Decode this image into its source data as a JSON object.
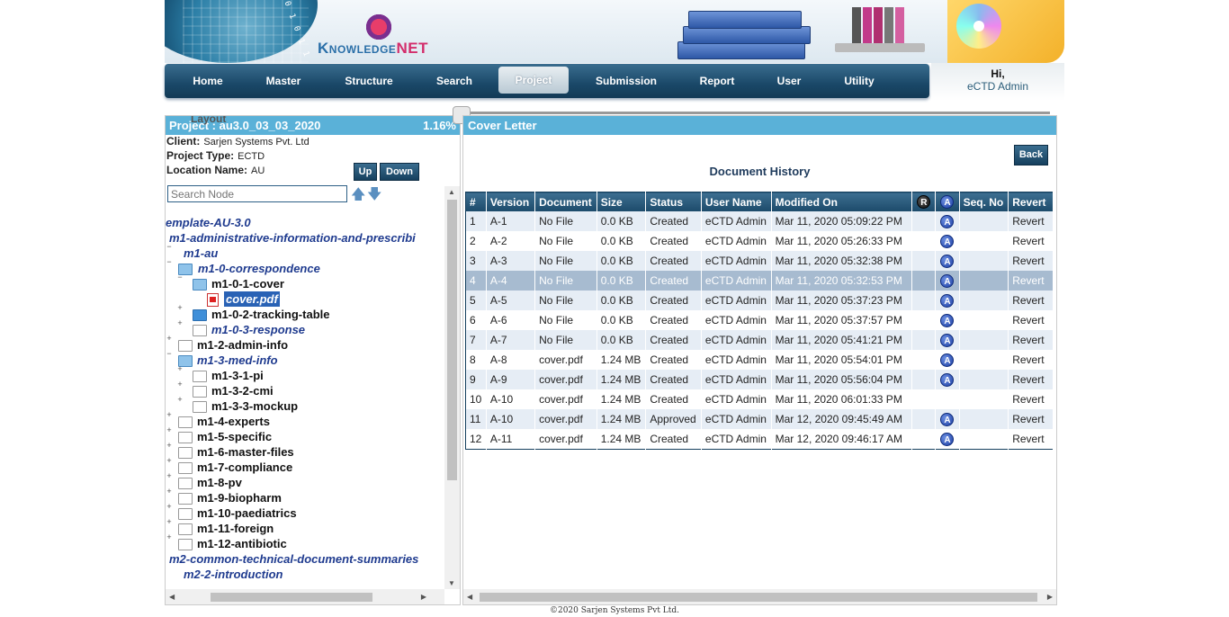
{
  "brand": {
    "logo_prefix": "Knowledge",
    "logo_suffix": "NET",
    "binary": "0 1 0 1 1 0 1 0"
  },
  "nav": {
    "items": [
      "Home",
      "Master",
      "Structure",
      "Search",
      "Project",
      "Submission",
      "Report",
      "User",
      "Utility"
    ],
    "active": "Project"
  },
  "user": {
    "greeting": "Hi,",
    "name": "eCTD Admin"
  },
  "left": {
    "header_label": "Project : au3.0_03_03_2020",
    "overlay_label": "Layout",
    "percent": "1.16%",
    "client_label": "Client:",
    "client_value": "Sarjen Systems Pvt. Ltd",
    "type_label": "Project Type:",
    "type_value": "ECTD",
    "location_label": "Location Name:",
    "location_value": "AU",
    "up_button": "Up",
    "down_button": "Down",
    "search_placeholder": "Search Node",
    "tree": [
      {
        "label": "emplate-AU-3.0",
        "style": "it"
      },
      {
        "label": "m1-administrative-information-and-prescribi",
        "style": "it"
      },
      {
        "label": "m1-au",
        "style": "it"
      },
      {
        "label": "m1-0-correspondence",
        "style": "it"
      },
      {
        "label": "m1-0-1-cover",
        "style": "bk"
      },
      {
        "label": "cover.pdf",
        "style": "sel"
      },
      {
        "label": "m1-0-2-tracking-table",
        "style": "bk"
      },
      {
        "label": "m1-0-3-response",
        "style": "it"
      },
      {
        "label": "m1-2-admin-info",
        "style": "bk"
      },
      {
        "label": "m1-3-med-info",
        "style": "it"
      },
      {
        "label": "m1-3-1-pi",
        "style": "bk"
      },
      {
        "label": "m1-3-2-cmi",
        "style": "bk"
      },
      {
        "label": "m1-3-3-mockup",
        "style": "bk"
      },
      {
        "label": "m1-4-experts",
        "style": "bk"
      },
      {
        "label": "m1-5-specific",
        "style": "bk"
      },
      {
        "label": "m1-6-master-files",
        "style": "bk"
      },
      {
        "label": "m1-7-compliance",
        "style": "bk"
      },
      {
        "label": "m1-8-pv",
        "style": "bk"
      },
      {
        "label": "m1-9-biopharm",
        "style": "bk"
      },
      {
        "label": "m1-10-paediatrics",
        "style": "bk"
      },
      {
        "label": "m1-11-foreign",
        "style": "bk"
      },
      {
        "label": "m1-12-antibiotic",
        "style": "bk"
      },
      {
        "label": "m2-common-technical-document-summaries",
        "style": "it"
      },
      {
        "label": "m2-2-introduction",
        "style": "it"
      }
    ]
  },
  "right": {
    "header": "Cover Letter",
    "back_button": "Back",
    "title": "Document History",
    "columns": [
      "#",
      "Version",
      "Document",
      "Size",
      "Status",
      "User Name",
      "Modified On",
      "R",
      "A",
      "Seq. No",
      "Revert"
    ],
    "rows": [
      [
        "1",
        "A-1",
        "No File",
        "0.0 KB",
        "Created",
        "eCTD Admin",
        "Mar 11, 2020 05:09:22 PM",
        "",
        "A",
        "",
        "Revert"
      ],
      [
        "2",
        "A-2",
        "No File",
        "0.0 KB",
        "Created",
        "eCTD Admin",
        "Mar 11, 2020 05:26:33 PM",
        "",
        "A",
        "",
        "Revert"
      ],
      [
        "3",
        "A-3",
        "No File",
        "0.0 KB",
        "Created",
        "eCTD Admin",
        "Mar 11, 2020 05:32:38 PM",
        "",
        "A",
        "",
        "Revert"
      ],
      [
        "4",
        "A-4",
        "No File",
        "0.0 KB",
        "Created",
        "eCTD Admin",
        "Mar 11, 2020 05:32:53 PM",
        "",
        "A",
        "",
        "Revert"
      ],
      [
        "5",
        "A-5",
        "No File",
        "0.0 KB",
        "Created",
        "eCTD Admin",
        "Mar 11, 2020 05:37:23 PM",
        "",
        "A",
        "",
        "Revert"
      ],
      [
        "6",
        "A-6",
        "No File",
        "0.0 KB",
        "Created",
        "eCTD Admin",
        "Mar 11, 2020 05:37:57 PM",
        "",
        "A",
        "",
        "Revert"
      ],
      [
        "7",
        "A-7",
        "No File",
        "0.0 KB",
        "Created",
        "eCTD Admin",
        "Mar 11, 2020 05:41:21 PM",
        "",
        "A",
        "",
        "Revert"
      ],
      [
        "8",
        "A-8",
        "cover.pdf",
        "1.24 MB",
        "Created",
        "eCTD Admin",
        "Mar 11, 2020 05:54:01 PM",
        "",
        "A",
        "",
        "Revert"
      ],
      [
        "9",
        "A-9",
        "cover.pdf",
        "1.24 MB",
        "Created",
        "eCTD Admin",
        "Mar 11, 2020 05:56:04 PM",
        "",
        "A",
        "",
        "Revert"
      ],
      [
        "10",
        "A-10",
        "cover.pdf",
        "1.24 MB",
        "Created",
        "eCTD Admin",
        "Mar 11, 2020 06:01:33 PM",
        "",
        "",
        "",
        "Revert"
      ],
      [
        "11",
        "A-10",
        "cover.pdf",
        "1.24 MB",
        "Approved",
        "eCTD Admin",
        "Mar 12, 2020 09:45:49 AM",
        "",
        "A",
        "",
        "Revert"
      ],
      [
        "12",
        "A-11",
        "cover.pdf",
        "1.24 MB",
        "Created",
        "eCTD Admin",
        "Mar 12, 2020 09:46:17 AM",
        "",
        "A",
        "",
        "Revert"
      ]
    ],
    "highlighted_row": 4
  },
  "footer": "©2020 Sarjen Systems Pvt Ltd."
}
